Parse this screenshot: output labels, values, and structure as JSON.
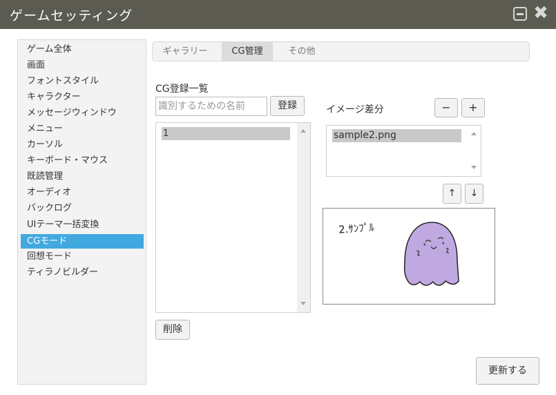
{
  "window": {
    "title": "ゲームセッティング"
  },
  "sidebar": {
    "items": [
      {
        "label": "ゲーム全体"
      },
      {
        "label": "画面"
      },
      {
        "label": "フォントスタイル"
      },
      {
        "label": "キャラクター"
      },
      {
        "label": "メッセージウィンドウ"
      },
      {
        "label": "メニュー"
      },
      {
        "label": "カーソル"
      },
      {
        "label": "キーボード・マウス"
      },
      {
        "label": "既読管理"
      },
      {
        "label": "オーディオ"
      },
      {
        "label": "バックログ"
      },
      {
        "label": "UIテーマ一括変換"
      },
      {
        "label": "CGモード",
        "active": true
      },
      {
        "label": "回想モード"
      },
      {
        "label": "ティラノビルダー"
      }
    ]
  },
  "tabs": [
    {
      "label": "ギャラリー"
    },
    {
      "label": "CG管理",
      "active": true
    },
    {
      "label": "その他"
    }
  ],
  "cg_list": {
    "heading": "CG登録一覧",
    "name_placeholder": "識別するための名前",
    "register_label": "登録",
    "items": [
      "1"
    ],
    "delete_label": "削除"
  },
  "image_diff": {
    "heading": "イメージ差分",
    "minus_label": "−",
    "plus_label": "+",
    "items": [
      "sample2.png"
    ],
    "up_label": "↑",
    "down_label": "↓",
    "preview_text": "2.ｻﾝﾌﾟﾙ"
  },
  "update_label": "更新する",
  "colors": {
    "titlebar": "#5c5b52",
    "accent": "#42a9e0",
    "ghost": "#c0a8e0"
  }
}
